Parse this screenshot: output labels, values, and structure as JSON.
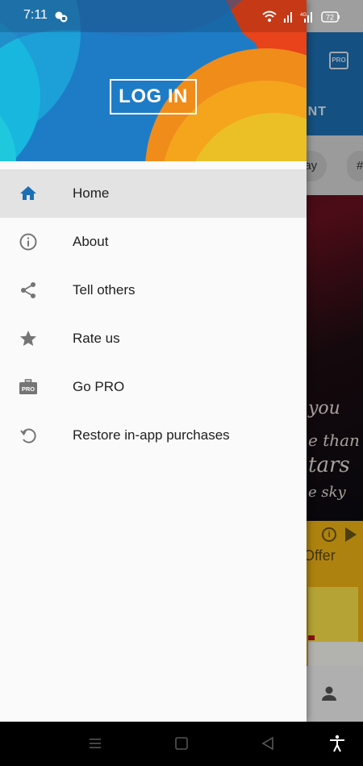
{
  "status_bar": {
    "time": "7:11",
    "battery": "72",
    "network_label": "4G"
  },
  "background_app": {
    "tab_label_partial": "ENT",
    "chip_partial": "lay",
    "chip_partial_2": "#",
    "poster_text_lines": [
      "you",
      "e than",
      "tars",
      "e sky"
    ],
    "ad_text_partial": "Offer",
    "pro_badge": "PRO"
  },
  "drawer": {
    "login_label": "LOG IN",
    "menu": [
      {
        "label": "Home",
        "icon": "home-icon",
        "active": true
      },
      {
        "label": "About",
        "icon": "info-icon",
        "active": false
      },
      {
        "label": "Tell others",
        "icon": "share-icon",
        "active": false
      },
      {
        "label": "Rate us",
        "icon": "star-icon",
        "active": false
      },
      {
        "label": "Go PRO",
        "icon": "pro-briefcase-icon",
        "active": false,
        "badge": "PRO"
      },
      {
        "label": "Restore in-app purchases",
        "icon": "restore-icon",
        "active": false
      }
    ]
  },
  "colors": {
    "accent_blue": "#1c6fb3",
    "active_row": "#e3e3e3",
    "icon_gray": "#757575"
  }
}
